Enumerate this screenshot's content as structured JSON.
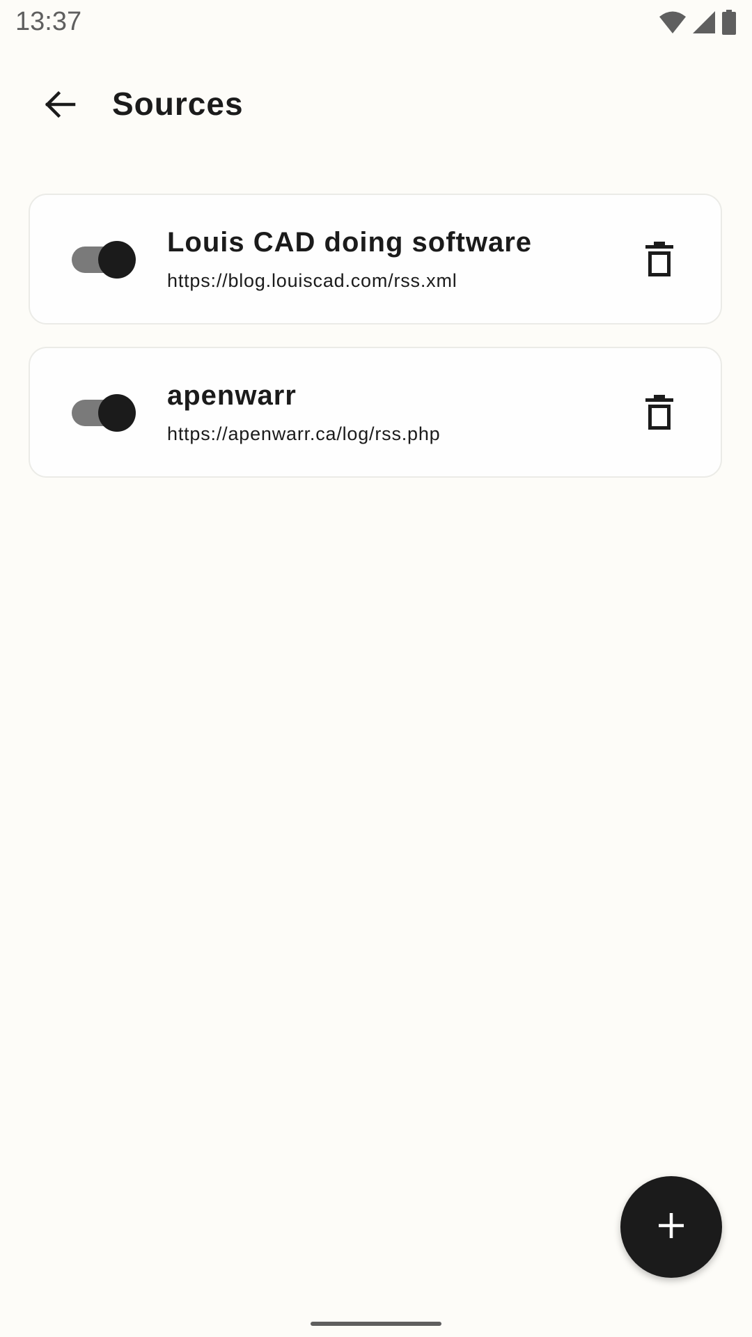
{
  "status_bar": {
    "time": "13:37",
    "icons": [
      "wifi-icon",
      "cellular-signal-icon",
      "battery-icon"
    ]
  },
  "app_bar": {
    "back_icon": "arrow-back-icon",
    "title": "Sources"
  },
  "sources": [
    {
      "name": "Louis CAD doing software",
      "url": "https://blog.louiscad.com/rss.xml",
      "enabled": true
    },
    {
      "name": "apenwarr",
      "url": "https://apenwarr.ca/log/rss.php",
      "enabled": true
    }
  ],
  "fab": {
    "icon": "add-icon"
  },
  "colors": {
    "background": "#fdfcf8",
    "primary": "#1b1b1b",
    "toggle_track": "#7a7a7a",
    "card_border": "#ebebe7"
  }
}
